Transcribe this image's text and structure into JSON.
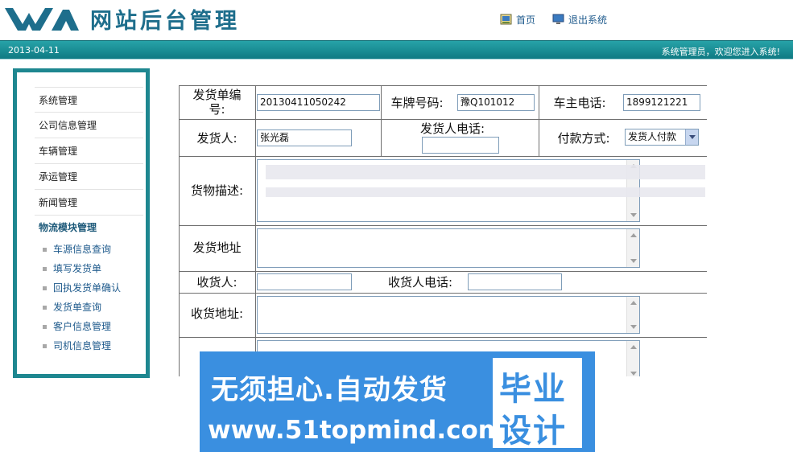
{
  "header": {
    "site_title": "网站后台管理",
    "home_link": "首页",
    "logout_link": "退出系统"
  },
  "bar": {
    "date": "2013-04-11",
    "welcome": "系统管理员，欢迎您进入系统!"
  },
  "sidebar": {
    "items": [
      {
        "label": "系统管理"
      },
      {
        "label": "公司信息管理"
      },
      {
        "label": "车辆管理"
      },
      {
        "label": "承运管理"
      },
      {
        "label": "新闻管理"
      }
    ],
    "group_label": "物流模块管理",
    "sub_items": [
      {
        "label": "车源信息查询"
      },
      {
        "label": "填写发货单"
      },
      {
        "label": "回执发货单确认"
      },
      {
        "label": "发货单查询"
      },
      {
        "label": "客户信息管理"
      },
      {
        "label": "司机信息管理"
      }
    ]
  },
  "form": {
    "order_no_label": "发货单编号:",
    "order_no_value": "20130411050242",
    "plate_label": "车牌号码:",
    "plate_value": "豫Q101012",
    "owner_phone_label": "车主电话:",
    "owner_phone_value": "1899121221",
    "sender_label": "发货人:",
    "sender_value": "张光磊",
    "sender_phone_label": "发货人电话:",
    "sender_phone_value": "",
    "payment_label": "付款方式:",
    "payment_value": "发货人付款",
    "goods_label": "货物描述:",
    "ship_address_label": "发货地址",
    "receiver_label": "收货人:",
    "receiver_value": "",
    "receiver_phone_label": "收货人电话:",
    "receiver_phone_value": "",
    "receive_address_label": "收货地址:"
  },
  "banner": {
    "line1": "无须担心.自动发货",
    "line2": "www.51topmind.com",
    "badge_line1": "毕业",
    "badge_line2": "设计"
  },
  "colors": {
    "accent": "#1e8790",
    "title": "#1e6e8c",
    "banner": "#3a8fe0"
  }
}
